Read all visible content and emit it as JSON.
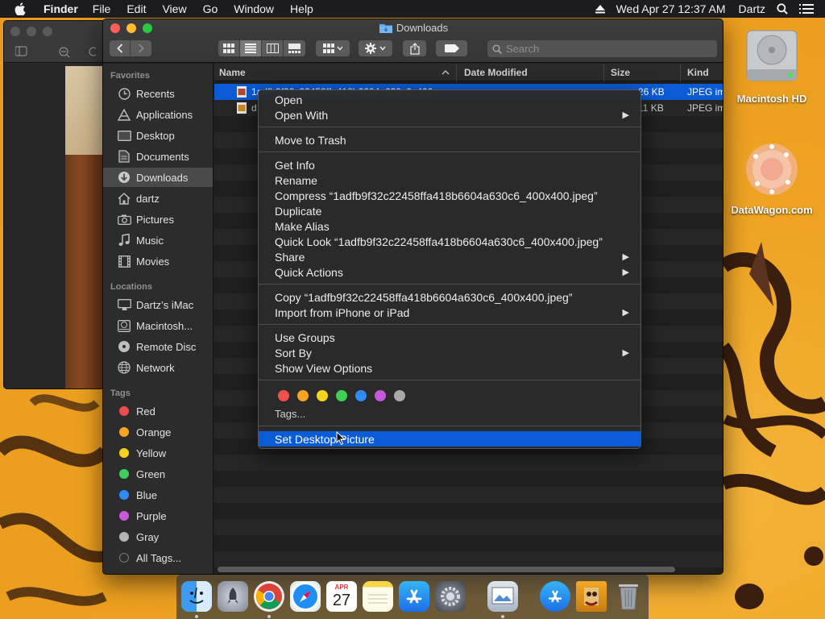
{
  "menubar": {
    "app_name": "Finder",
    "menus": [
      "File",
      "Edit",
      "View",
      "Go",
      "Window",
      "Help"
    ],
    "clock": "Wed Apr 27  12:37 AM",
    "user": "Dartz",
    "icons": [
      "apple-icon",
      "eject-icon",
      "spotlight-search-icon",
      "control-center-list-icon"
    ]
  },
  "finder": {
    "title": "Downloads",
    "search_placeholder": "Search",
    "sidebar": {
      "favorites_heading": "Favorites",
      "favorites": [
        {
          "label": "Recents",
          "icon": "clock-icon"
        },
        {
          "label": "Applications",
          "icon": "applications-icon"
        },
        {
          "label": "Desktop",
          "icon": "desktop-icon"
        },
        {
          "label": "Documents",
          "icon": "documents-icon"
        },
        {
          "label": "Downloads",
          "icon": "downloads-icon",
          "selected": true
        },
        {
          "label": "dartz",
          "icon": "home-icon"
        },
        {
          "label": "Pictures",
          "icon": "camera-icon"
        },
        {
          "label": "Music",
          "icon": "music-note-icon"
        },
        {
          "label": "Movies",
          "icon": "film-icon"
        }
      ],
      "locations_heading": "Locations",
      "locations": [
        {
          "label": "Dartz’s iMac",
          "icon": "imac-icon"
        },
        {
          "label": "Macintosh...",
          "icon": "hard-drive-icon"
        },
        {
          "label": "Remote Disc",
          "icon": "disc-icon"
        },
        {
          "label": "Network",
          "icon": "globe-icon"
        }
      ],
      "tags_heading": "Tags",
      "tags": [
        {
          "label": "Red",
          "color": "#ee4d4d"
        },
        {
          "label": "Orange",
          "color": "#f5a623"
        },
        {
          "label": "Yellow",
          "color": "#f7d020"
        },
        {
          "label": "Green",
          "color": "#3fcc5a"
        },
        {
          "label": "Blue",
          "color": "#2f8cf2"
        },
        {
          "label": "Purple",
          "color": "#c55bd6"
        },
        {
          "label": "Gray",
          "color": "#b5b5b5"
        },
        {
          "label": "All Tags...",
          "color": "#7a7a7a"
        }
      ]
    },
    "columns": {
      "name": "Name",
      "date": "Date Modified",
      "size": "Size",
      "kind": "Kind"
    },
    "files": [
      {
        "name": "1adfb9f32c22458ffa418b6604a630c6_400x400.jpeg",
        "date": "",
        "size": "26 KB",
        "kind": "JPEG image",
        "selected": true
      },
      {
        "name": "d",
        "date": "",
        "size": "11 KB",
        "kind": "JPEG image",
        "selected": false
      }
    ]
  },
  "context_menu": {
    "groups": [
      [
        {
          "label": "Open"
        },
        {
          "label": "Open With",
          "submenu": true
        }
      ],
      [
        {
          "label": "Move to Trash"
        }
      ],
      [
        {
          "label": "Get Info"
        },
        {
          "label": "Rename"
        },
        {
          "label": "Compress “1adfb9f32c22458ffa418b6604a630c6_400x400.jpeg”"
        },
        {
          "label": "Duplicate"
        },
        {
          "label": "Make Alias"
        },
        {
          "label": "Quick Look “1adfb9f32c22458ffa418b6604a630c6_400x400.jpeg”"
        },
        {
          "label": "Share",
          "submenu": true
        },
        {
          "label": "Quick Actions",
          "submenu": true
        }
      ],
      [
        {
          "label": "Copy “1adfb9f32c22458ffa418b6604a630c6_400x400.jpeg”"
        },
        {
          "label": "Import from iPhone or iPad",
          "submenu": true
        }
      ],
      [
        {
          "label": "Use Groups"
        },
        {
          "label": "Sort By",
          "submenu": true
        },
        {
          "label": "Show View Options"
        }
      ]
    ],
    "tag_colors": [
      "#f0504c",
      "#f6a423",
      "#f7d320",
      "#3fcf52",
      "#2f8cf2",
      "#c659d9",
      "#a9a9a9"
    ],
    "tags_label": "Tags...",
    "highlighted": "Set Desktop Picture"
  },
  "desktop": {
    "icons": [
      {
        "label": "Macintosh HD",
        "icon": "hard-drive-icon"
      },
      {
        "label": "DataWagon.com",
        "icon": "datawagon-logo-icon"
      }
    ]
  },
  "dock": {
    "apps": [
      {
        "name": "finder-app-icon"
      },
      {
        "name": "launchpad-app-icon"
      },
      {
        "name": "chrome-app-icon"
      },
      {
        "name": "safari-app-icon"
      },
      {
        "name": "calendar-app-icon",
        "month": "APR",
        "day": "27"
      },
      {
        "name": "notes-app-icon"
      },
      {
        "name": "app-store-app-icon"
      },
      {
        "name": "system-preferences-app-icon"
      },
      {
        "name": "preview-app-icon"
      },
      {
        "name": "app-store-downloads-icon"
      },
      {
        "name": "wallpaper-thumbnail-icon"
      },
      {
        "name": "trash-icon"
      }
    ]
  }
}
